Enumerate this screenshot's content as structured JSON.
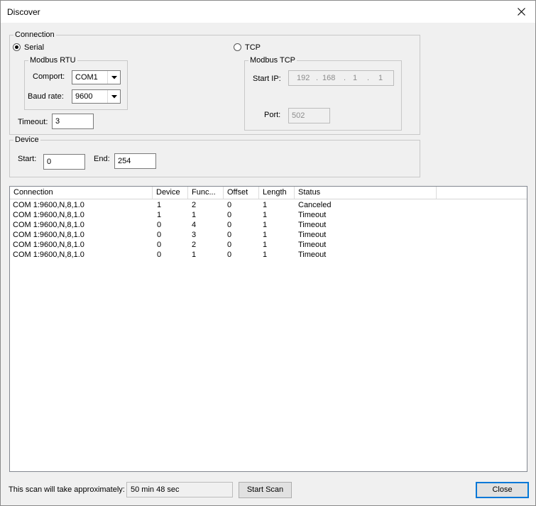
{
  "window": {
    "title": "Discover"
  },
  "connection": {
    "legend": "Connection",
    "serial_label": "Serial",
    "tcp_label": "TCP",
    "rtu": {
      "legend": "Modbus RTU",
      "comport_label": "Comport:",
      "comport_value": "COM1",
      "baud_label": "Baud rate:",
      "baud_value": "9600"
    },
    "timeout_label": "Timeout:",
    "timeout_value": "3",
    "tcp": {
      "legend": "Modbus TCP",
      "start_ip_label": "Start IP:",
      "ip": [
        "192",
        "168",
        "1",
        "1"
      ],
      "port_label": "Port:",
      "port_value": "502"
    }
  },
  "device": {
    "legend": "Device",
    "start_label": "Start:",
    "start_value": "0",
    "end_label": "End:",
    "end_value": "254"
  },
  "results": {
    "columns": [
      "Connection",
      "Device",
      "Func...",
      "Offset",
      "Length",
      "Status"
    ],
    "rows": [
      [
        "COM 1:9600,N,8,1.0",
        "1",
        "2",
        "0",
        "1",
        "Canceled"
      ],
      [
        "COM 1:9600,N,8,1.0",
        "1",
        "1",
        "0",
        "1",
        "Timeout"
      ],
      [
        "COM 1:9600,N,8,1.0",
        "0",
        "4",
        "0",
        "1",
        "Timeout"
      ],
      [
        "COM 1:9600,N,8,1.0",
        "0",
        "3",
        "0",
        "1",
        "Timeout"
      ],
      [
        "COM 1:9600,N,8,1.0",
        "0",
        "2",
        "0",
        "1",
        "Timeout"
      ],
      [
        "COM 1:9600,N,8,1.0",
        "0",
        "1",
        "0",
        "1",
        "Timeout"
      ]
    ]
  },
  "footer": {
    "estimate_label": "This scan will take approximately:",
    "estimate_value": "50 min 48 sec",
    "start_scan_label": "Start Scan",
    "close_label": "Close"
  }
}
